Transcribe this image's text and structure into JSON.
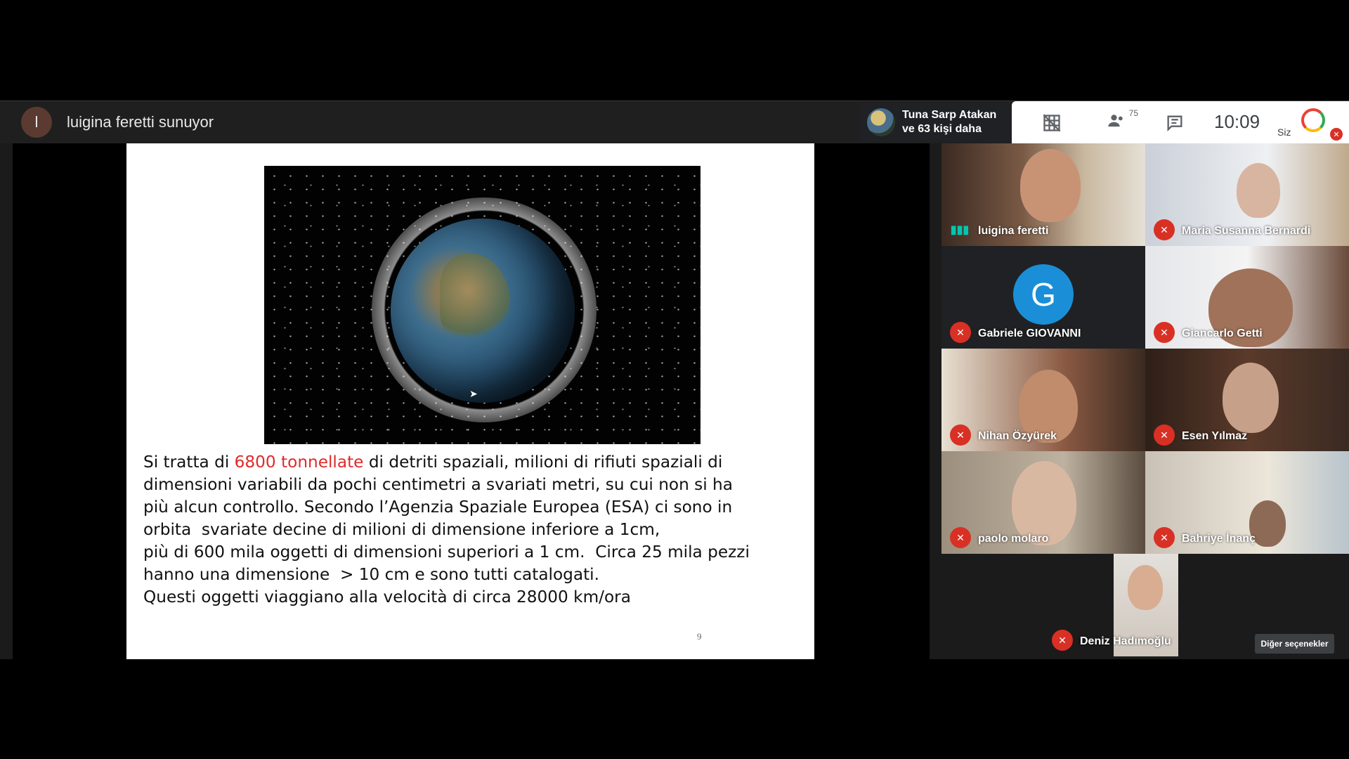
{
  "presenter": {
    "initial": "l",
    "title": "luigina feretti sunuyor"
  },
  "participants_summary": {
    "line1": "Tuna Sarp Atakan",
    "line2": "ve 63 kişi daha"
  },
  "toolbar": {
    "grid_icon": "grid-off-icon",
    "people_count": "75",
    "people_icon": "people-icon",
    "chat_icon": "chat-icon",
    "time": "10:09",
    "self_label": "Siz"
  },
  "slide": {
    "text_before": "Si tratta di ",
    "highlight": "6800 tonnellate",
    "text_after": " di detriti spaziali, milioni di rifiuti spaziali di\ndimensioni variabili da pochi centimetri a svariati metri, su cui non si ha\npiù alcun controllo. Secondo l’Agenzia Spaziale Europea (ESA) ci sono in\norbita  svariate decine di milioni di dimensione inferiore a 1cm,\npiù di 600 mila oggetti di dimensioni superiori a 1 cm.  Circa 25 mila pezzi\nhanno una dimensione  > 10 cm e sono tutti catalogati.\nQuesti oggetti viaggiano alla velocità di circa 28000 km/ora",
    "page_number": "9",
    "highlight_color": "#e02a2a"
  },
  "tiles": [
    {
      "name": "luigina feretti",
      "state": "speaking"
    },
    {
      "name": "Maria Susanna Bernardi",
      "state": "muted"
    },
    {
      "name": "Gabriele GIOVANNI",
      "state": "muted",
      "avatar_letter": "G"
    },
    {
      "name": "Giancarlo Getti",
      "state": "muted"
    },
    {
      "name": "Nihan Özyürek",
      "state": "muted"
    },
    {
      "name": "Esen Yılmaz",
      "state": "muted"
    },
    {
      "name": "paolo molaro",
      "state": "muted"
    },
    {
      "name": "Bahriye İnanç",
      "state": "muted"
    },
    {
      "name": "Deniz Hadımoğlu",
      "state": "muted"
    }
  ],
  "more_options": "Diğer seçenekler"
}
